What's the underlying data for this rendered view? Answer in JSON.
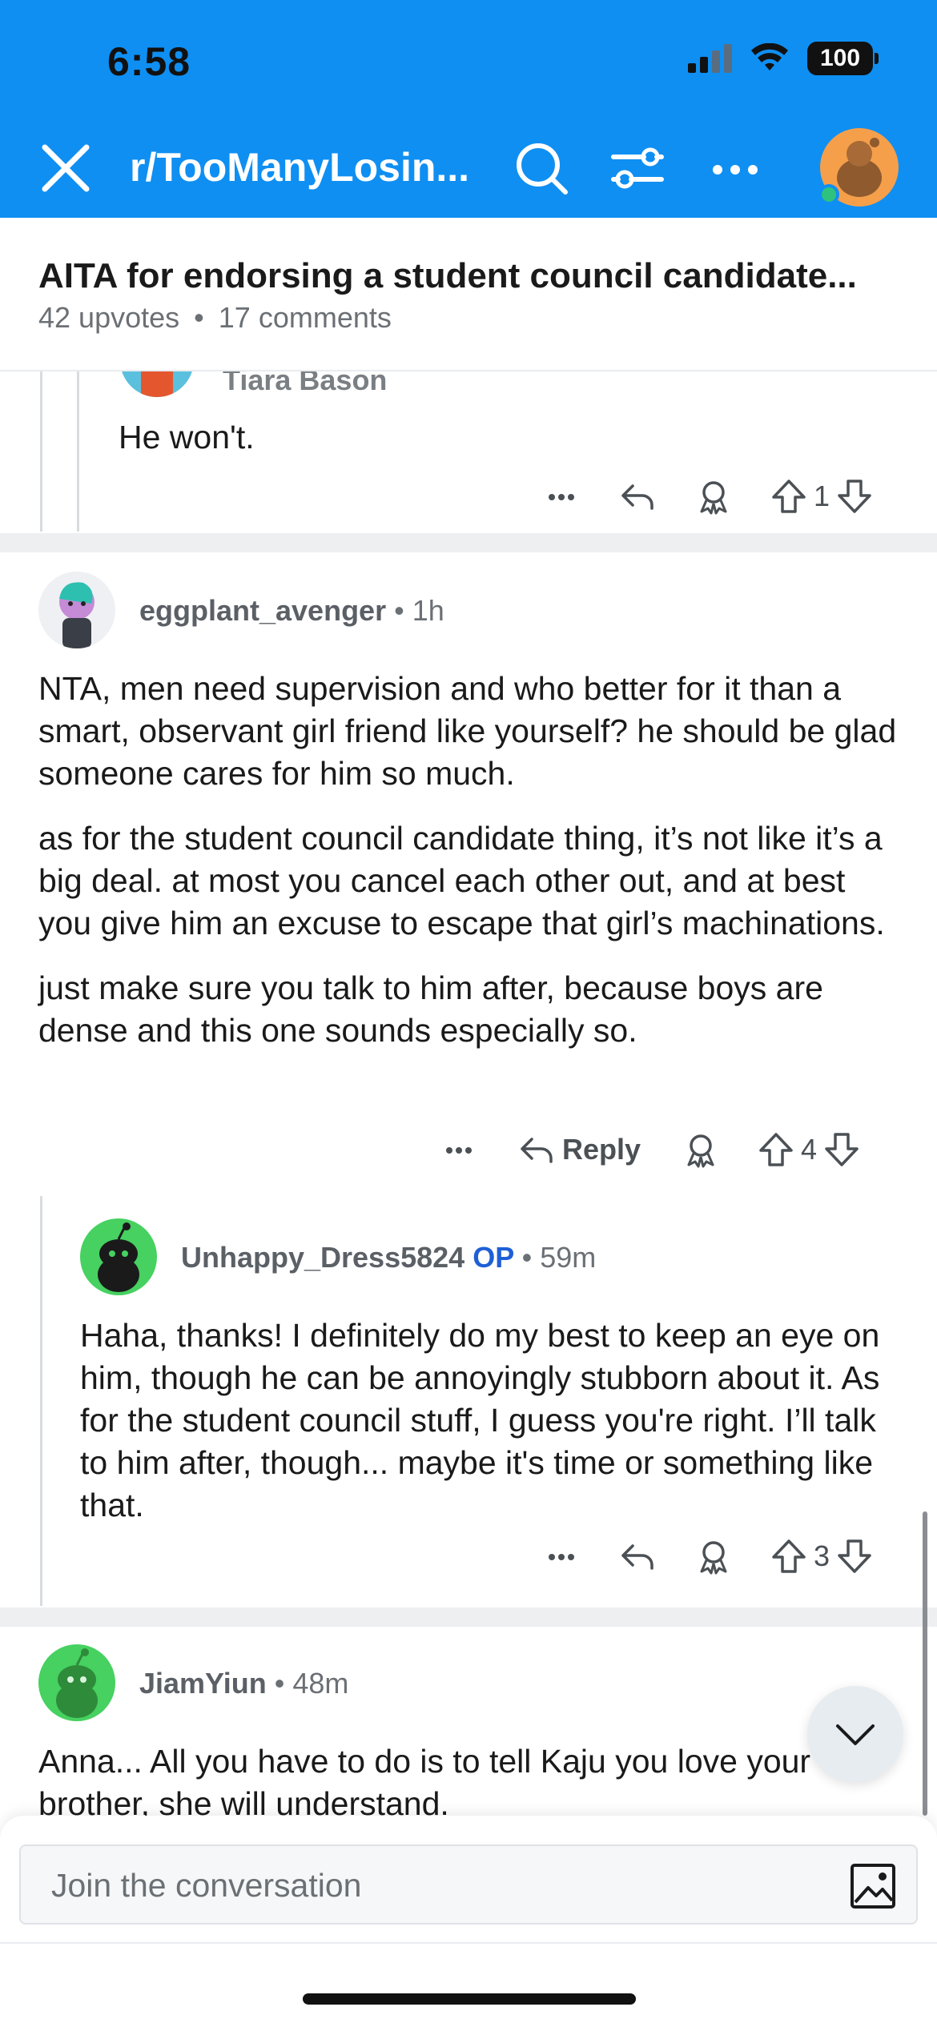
{
  "status_bar": {
    "time": "6:58",
    "battery": "100"
  },
  "header": {
    "subreddit": "r/TooManyLosin..."
  },
  "post": {
    "title": "AITA for endorsing a student council candidate...",
    "upvotes": "42 upvotes",
    "comments": "17 comments",
    "separator": "•"
  },
  "comments": [
    {
      "username": "Tiara Bason",
      "body": [
        "He won't."
      ],
      "votes": "1"
    },
    {
      "username": "eggplant_avenger",
      "time": "1h",
      "body": [
        "NTA, men need supervision and who better for it than a smart, observant girl friend like yourself? he should be glad someone cares for him so much.",
        "as for the student council candidate thing, it’s not like it’s a big deal. at most you cancel each other out, and at best you give him an excuse to escape that girl’s machinations.",
        "just make sure you talk to him after, because boys are dense and this one sounds especially so."
      ],
      "reply_label": "Reply",
      "votes": "4"
    },
    {
      "username": "Unhappy_Dress5824",
      "op_badge": "OP",
      "time": "59m",
      "body": [
        "Haha, thanks! I definitely do my best to keep an eye on him, though he can be annoyingly stubborn about it. As for the student council stuff, I guess you're right. I’ll talk to him after, though... maybe it's time or something like that."
      ],
      "votes": "3"
    },
    {
      "username": "JiamYiun",
      "time": "48m",
      "body": [
        "Anna... All you have to do is to tell Kaju you love your brother, she will understand."
      ]
    }
  ],
  "composer": {
    "placeholder": "Join the conversation"
  },
  "colors": {
    "header_bg": "#0f8ff2",
    "op_blue": "#1f5fd6",
    "avatar_green": "#46d160",
    "avatar_orange": "#f59f4b"
  },
  "icons": [
    "close-icon",
    "search-icon",
    "filter-icon",
    "more-icon",
    "reply-icon",
    "award-icon",
    "upvote-icon",
    "downvote-icon",
    "chevron-down-icon",
    "image-icon"
  ]
}
